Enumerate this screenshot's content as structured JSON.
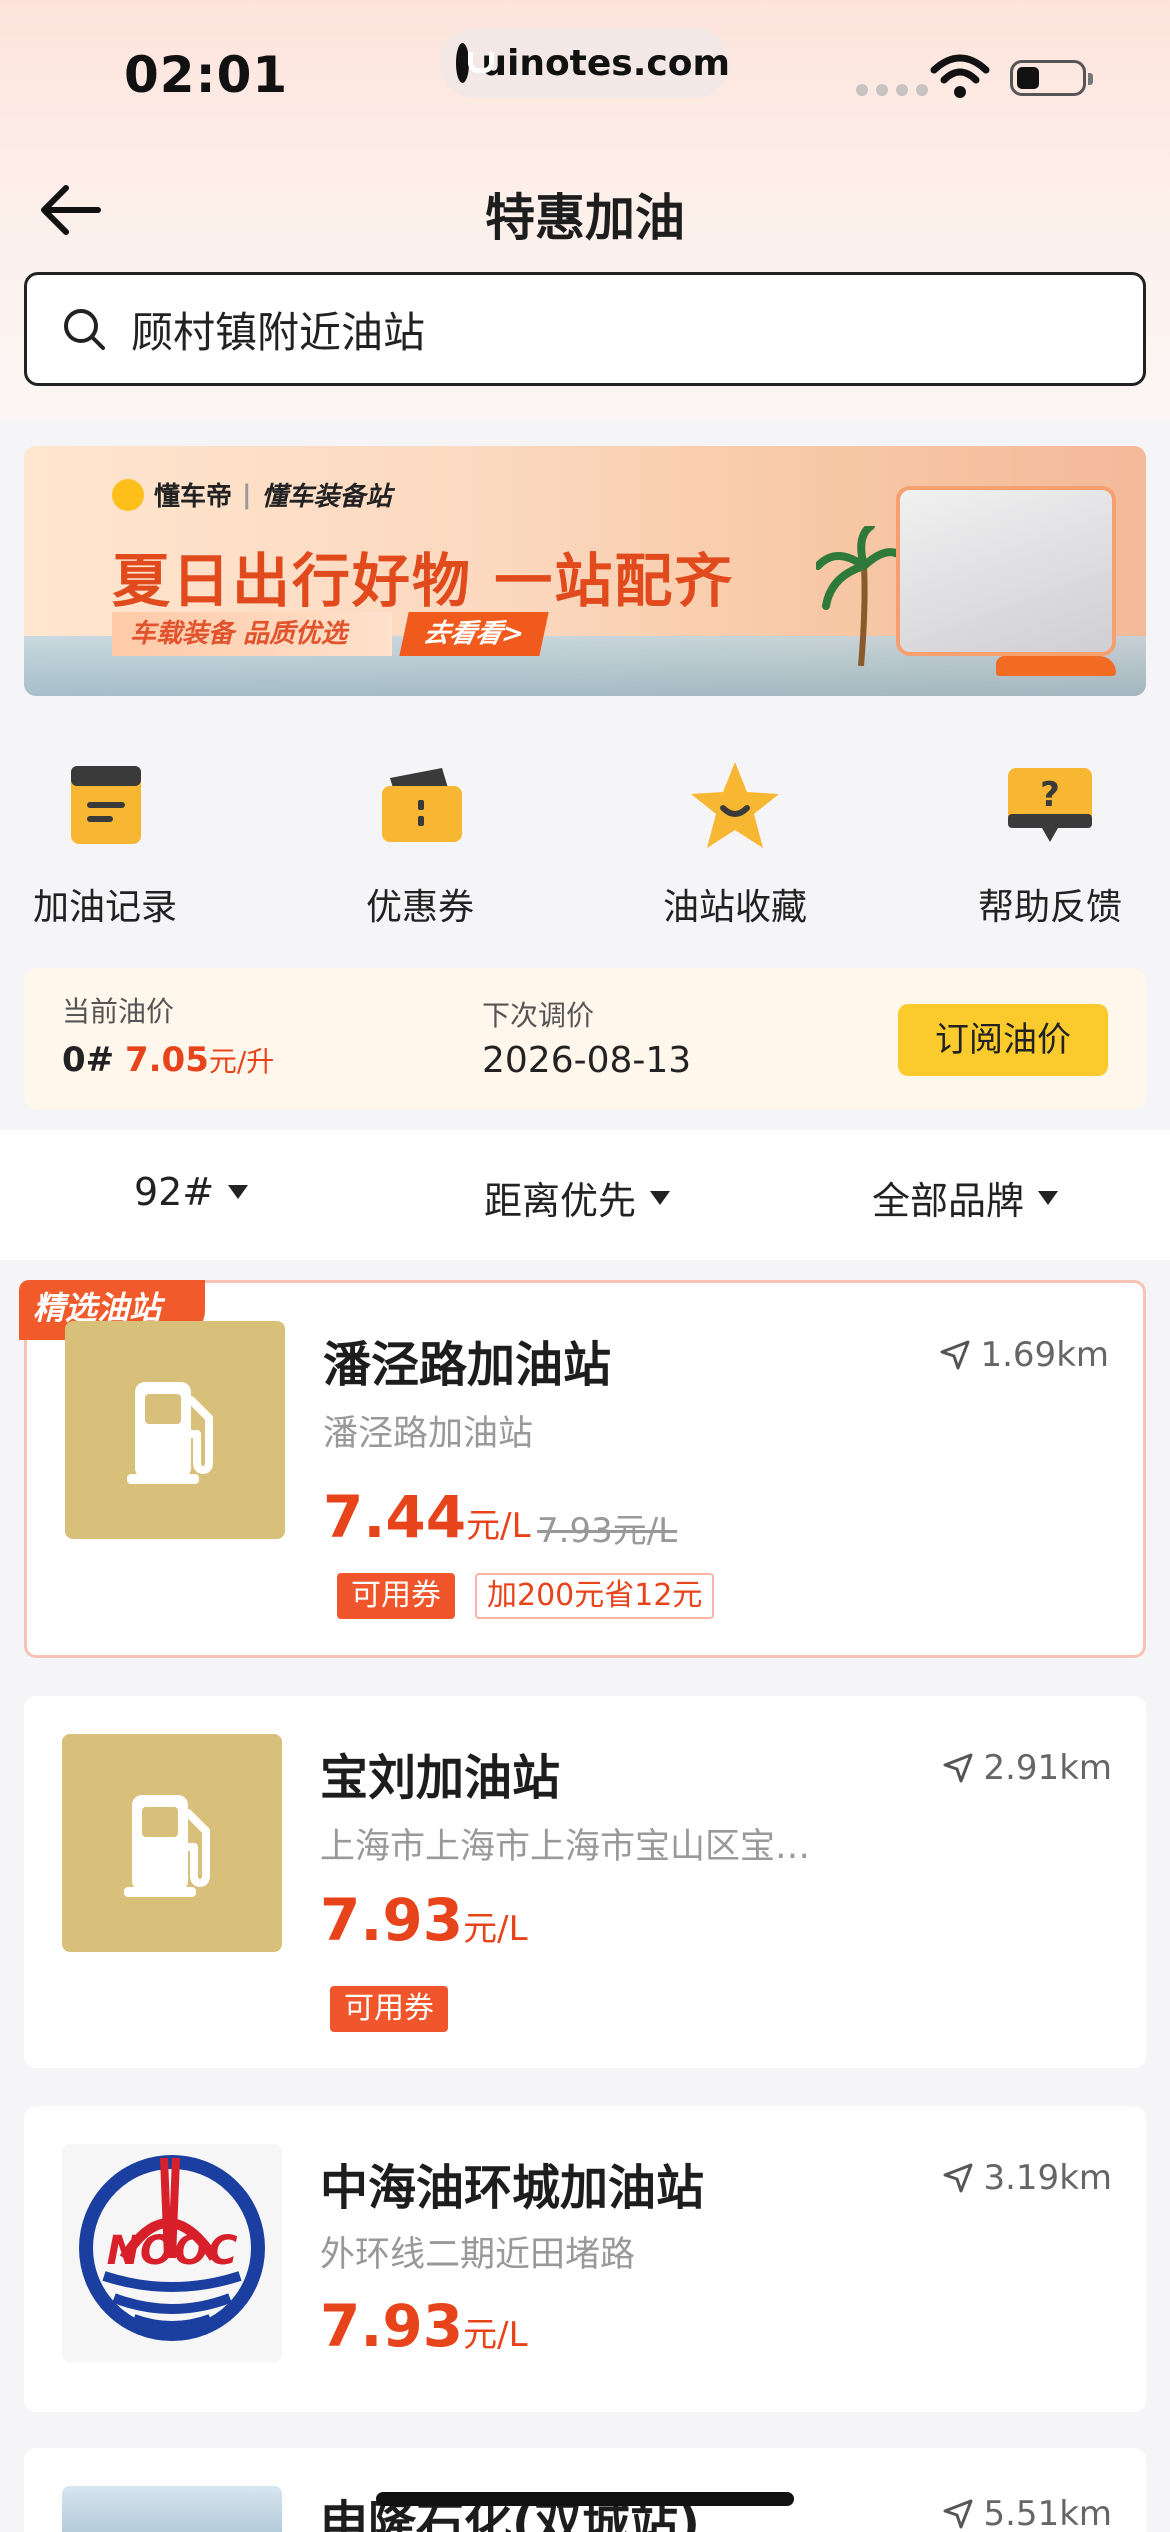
{
  "status_bar": {
    "time": "02:01",
    "url": "uinotes.com"
  },
  "nav": {
    "title": "特惠加油"
  },
  "search": {
    "text": "顾村镇附近油站"
  },
  "banner": {
    "brand": "懂车帝",
    "brand_sub": "懂车装备站",
    "headline": "夏日出行好物 一站配齐",
    "sub": "车载装备 品质优选",
    "cta": "去看看>"
  },
  "shortcuts": [
    {
      "label": "加油记录",
      "icon": "fuel-record-icon"
    },
    {
      "label": "优惠券",
      "icon": "coupon-icon"
    },
    {
      "label": "油站收藏",
      "icon": "star-favorite-icon"
    },
    {
      "label": "帮助反馈",
      "icon": "help-feedback-icon"
    }
  ],
  "price_info": {
    "current_label": "当前油价",
    "grade": "0#",
    "price": "7.05",
    "unit": "元/升",
    "next_label": "下次调价",
    "next_date": "2026-08-13",
    "subscribe": "订阅油价"
  },
  "filters": [
    {
      "label": "92#"
    },
    {
      "label": "距离优先"
    },
    {
      "label": "全部品牌"
    }
  ],
  "stations": [
    {
      "featured_tag": "精选油站",
      "name": "潘泾路加油站",
      "address": "潘泾路加油站",
      "price": "7.44",
      "unit": "元/L",
      "old_price": "7.93元/L",
      "distance": "1.69km",
      "tags": [
        "可用券"
      ],
      "promo": "加200元省12元"
    },
    {
      "name": "宝刘加油站",
      "address": "上海市上海市上海市宝山区宝…",
      "price": "7.93",
      "unit": "元/L",
      "distance": "2.91km",
      "tags": [
        "可用券"
      ]
    },
    {
      "name": "中海油环城加油站",
      "address": "外环线二期近田堵路",
      "price": "7.93",
      "unit": "元/L",
      "distance": "3.19km"
    },
    {
      "name": "申隆石化(双城站)",
      "distance": "5.51km"
    }
  ],
  "colors": {
    "accent": "#e8441c",
    "button_yellow": "#fbcb2d",
    "thumb_gold": "#d8c07a"
  }
}
